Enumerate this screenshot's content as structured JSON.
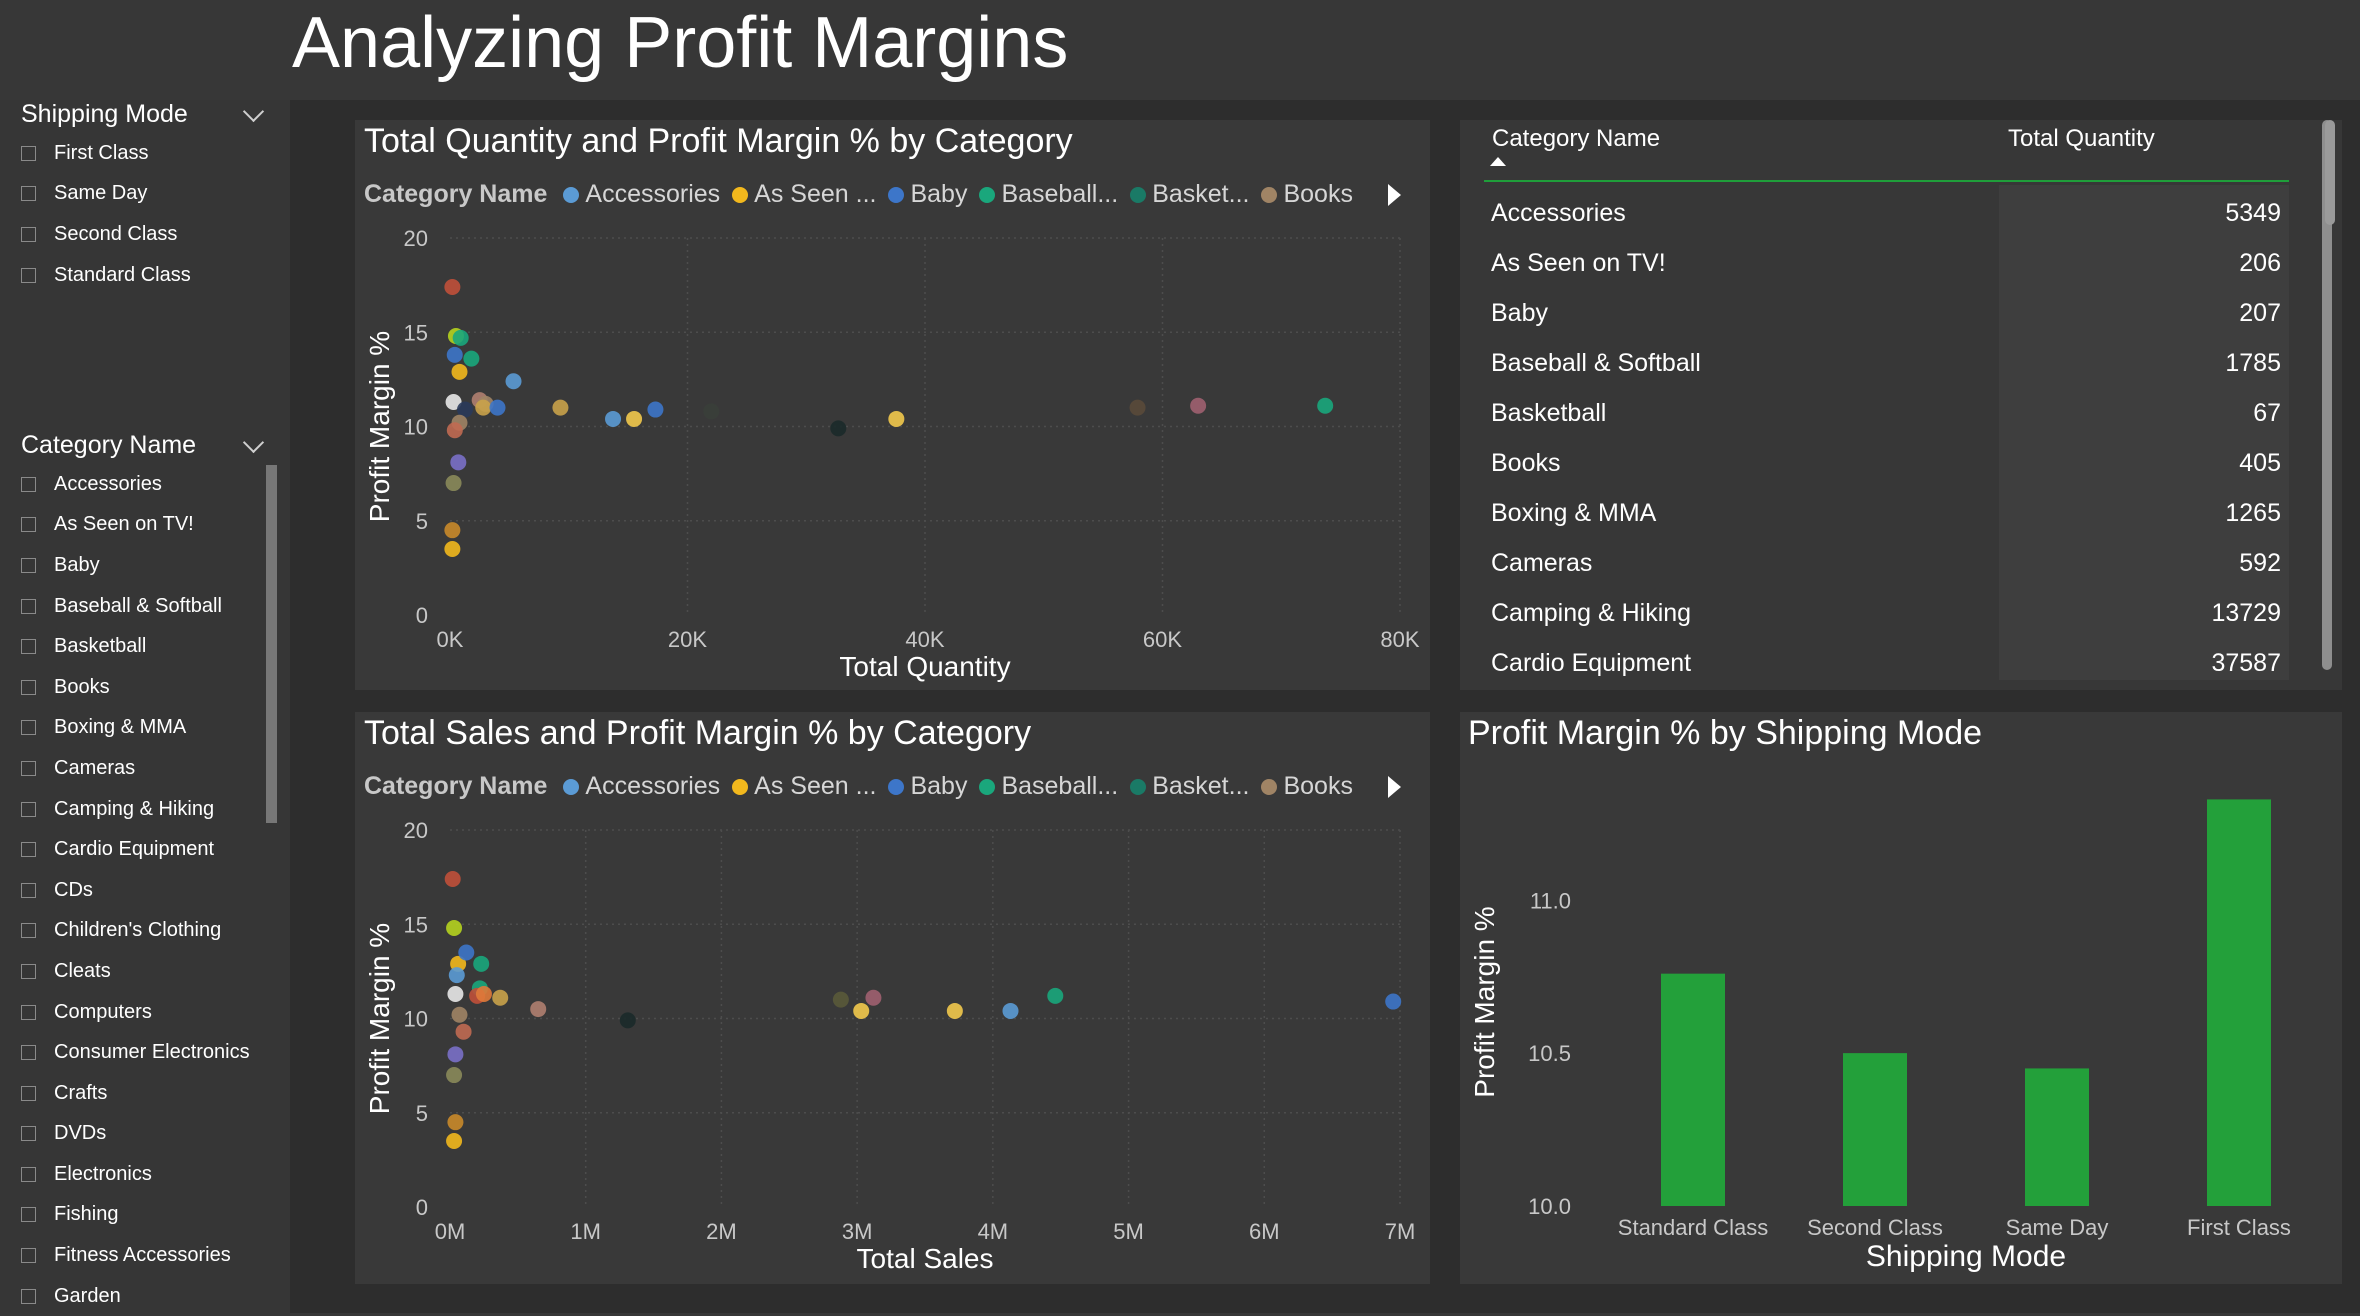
{
  "page_title": "Analyzing Profit Margins",
  "slicers": {
    "shipping": {
      "header": "Shipping Mode",
      "items": [
        "First Class",
        "Same Day",
        "Second Class",
        "Standard Class"
      ]
    },
    "category": {
      "header": "Category Name",
      "items": [
        "Accessories",
        "As Seen on TV!",
        "Baby",
        "Baseball & Softball",
        "Basketball",
        "Books",
        "Boxing & MMA",
        "Cameras",
        "Camping & Hiking",
        "Cardio Equipment",
        "CDs",
        "Children's Clothing",
        "Cleats",
        "Computers",
        "Consumer Electronics",
        "Crafts",
        "DVDs",
        "Electronics",
        "Fishing",
        "Fitness Accessories",
        "Garden"
      ]
    }
  },
  "legend": {
    "title": "Category Name",
    "items": [
      {
        "label": "Accessories",
        "color": "#5b9bd5"
      },
      {
        "label": "As Seen ...",
        "color": "#f2b81d"
      },
      {
        "label": "Baby",
        "color": "#3d76c9"
      },
      {
        "label": "Baseball...",
        "color": "#1aa77c"
      },
      {
        "label": "Basket...",
        "color": "#1a7a66"
      },
      {
        "label": "Books",
        "color": "#a08465"
      }
    ]
  },
  "table": {
    "headers": {
      "category": "Category Name",
      "quantity": "Total Quantity"
    },
    "rows": [
      {
        "name": "Accessories",
        "qty": "5349"
      },
      {
        "name": "As Seen on TV!",
        "qty": "206"
      },
      {
        "name": "Baby",
        "qty": "207"
      },
      {
        "name": "Baseball & Softball",
        "qty": "1785"
      },
      {
        "name": "Basketball",
        "qty": "67"
      },
      {
        "name": "Books",
        "qty": "405"
      },
      {
        "name": "Boxing & MMA",
        "qty": "1265"
      },
      {
        "name": "Cameras",
        "qty": "592"
      },
      {
        "name": "Camping & Hiking",
        "qty": "13729"
      },
      {
        "name": "Cardio Equipment",
        "qty": "37587"
      }
    ]
  },
  "chart_data": [
    {
      "type": "scatter",
      "title": "Total Quantity and Profit Margin % by Category",
      "xlabel": "Total Quantity",
      "ylabel": "Profit Margin %",
      "xlim": [
        0,
        80000
      ],
      "ylim": [
        0,
        20
      ],
      "xticks": [
        0,
        20000,
        40000,
        60000,
        80000
      ],
      "xtick_labels": [
        "0K",
        "20K",
        "40K",
        "60K",
        "80K"
      ],
      "yticks": [
        0,
        5,
        10,
        15,
        20
      ],
      "ytick_labels": [
        "0",
        "5",
        "10",
        "15",
        "20"
      ],
      "grid": true,
      "legend_position": "top",
      "points": [
        {
          "x": 200,
          "y": 17.4,
          "color": "#c0503a"
        },
        {
          "x": 500,
          "y": 14.8,
          "color": "#b5d31f"
        },
        {
          "x": 900,
          "y": 14.7,
          "color": "#1aa77c"
        },
        {
          "x": 1800,
          "y": 13.6,
          "color": "#1aa77c"
        },
        {
          "x": 400,
          "y": 13.8,
          "color": "#3d76c9"
        },
        {
          "x": 800,
          "y": 12.9,
          "color": "#f2b81d"
        },
        {
          "x": 5349,
          "y": 12.4,
          "color": "#5b9bd5"
        },
        {
          "x": 300,
          "y": 11.3,
          "color": "#e8e8e8"
        },
        {
          "x": 1265,
          "y": 10.9,
          "color": "#2a3a5a"
        },
        {
          "x": 2500,
          "y": 11.4,
          "color": "#b08070"
        },
        {
          "x": 3000,
          "y": 11.2,
          "color": "#a08465"
        },
        {
          "x": 2800,
          "y": 11.0,
          "color": "#c9a24a"
        },
        {
          "x": 4000,
          "y": 11.0,
          "color": "#3d76c9"
        },
        {
          "x": 800,
          "y": 10.2,
          "color": "#a08465"
        },
        {
          "x": 405,
          "y": 9.8,
          "color": "#c06a52"
        },
        {
          "x": 700,
          "y": 8.1,
          "color": "#7a70c8"
        },
        {
          "x": 300,
          "y": 7.0,
          "color": "#8a8a5a"
        },
        {
          "x": 200,
          "y": 4.5,
          "color": "#c98a2a"
        },
        {
          "x": 200,
          "y": 3.5,
          "color": "#f2b81d"
        },
        {
          "x": 9300,
          "y": 11.0,
          "color": "#c9a24a"
        },
        {
          "x": 13729,
          "y": 10.4,
          "color": "#5b9bd5"
        },
        {
          "x": 15500,
          "y": 10.4,
          "color": "#f2c94c"
        },
        {
          "x": 17300,
          "y": 10.9,
          "color": "#3d76c9"
        },
        {
          "x": 22000,
          "y": 10.8,
          "color": "#3a3f3a"
        },
        {
          "x": 32700,
          "y": 9.9,
          "color": "#1b2a2a"
        },
        {
          "x": 37587,
          "y": 10.4,
          "color": "#f2c94c"
        },
        {
          "x": 57900,
          "y": 11.0,
          "color": "#5a4a3a"
        },
        {
          "x": 63000,
          "y": 11.1,
          "color": "#a06070"
        },
        {
          "x": 73700,
          "y": 11.1,
          "color": "#1aa77c"
        }
      ]
    },
    {
      "type": "scatter",
      "title": "Total Sales and Profit Margin % by Category",
      "xlabel": "Total Sales",
      "ylabel": "Profit Margin %",
      "xlim": [
        0,
        7000000
      ],
      "ylim": [
        0,
        20
      ],
      "xticks": [
        0,
        1000000,
        2000000,
        3000000,
        4000000,
        5000000,
        6000000,
        7000000
      ],
      "xtick_labels": [
        "0M",
        "1M",
        "2M",
        "3M",
        "4M",
        "5M",
        "6M",
        "7M"
      ],
      "yticks": [
        0,
        5,
        10,
        15,
        20
      ],
      "ytick_labels": [
        "0",
        "5",
        "10",
        "15",
        "20"
      ],
      "grid": true,
      "legend_position": "top",
      "points": [
        {
          "x": 20000,
          "y": 17.4,
          "color": "#c0503a"
        },
        {
          "x": 30000,
          "y": 14.8,
          "color": "#b5d31f"
        },
        {
          "x": 60000,
          "y": 12.9,
          "color": "#f2b81d"
        },
        {
          "x": 120000,
          "y": 13.5,
          "color": "#3d76c9"
        },
        {
          "x": 230000,
          "y": 12.9,
          "color": "#1aa77c"
        },
        {
          "x": 50000,
          "y": 12.3,
          "color": "#5b9bd5"
        },
        {
          "x": 220000,
          "y": 11.6,
          "color": "#1aa77c"
        },
        {
          "x": 40000,
          "y": 11.3,
          "color": "#e8e8e8"
        },
        {
          "x": 200000,
          "y": 11.2,
          "color": "#c0503a"
        },
        {
          "x": 250000,
          "y": 11.3,
          "color": "#e07a3a"
        },
        {
          "x": 370000,
          "y": 11.1,
          "color": "#c9a24a"
        },
        {
          "x": 650000,
          "y": 10.5,
          "color": "#b08070"
        },
        {
          "x": 70000,
          "y": 10.2,
          "color": "#a08465"
        },
        {
          "x": 100000,
          "y": 9.3,
          "color": "#c06a52"
        },
        {
          "x": 40000,
          "y": 8.1,
          "color": "#7a70c8"
        },
        {
          "x": 30000,
          "y": 7.0,
          "color": "#8a8a5a"
        },
        {
          "x": 40000,
          "y": 4.5,
          "color": "#c98a2a"
        },
        {
          "x": 30000,
          "y": 3.5,
          "color": "#f2b81d"
        },
        {
          "x": 1310000,
          "y": 9.9,
          "color": "#1b2a2a"
        },
        {
          "x": 2880000,
          "y": 11.0,
          "color": "#5a5a3a"
        },
        {
          "x": 3030000,
          "y": 10.4,
          "color": "#f2c94c"
        },
        {
          "x": 3120000,
          "y": 11.1,
          "color": "#a06070"
        },
        {
          "x": 3720000,
          "y": 10.4,
          "color": "#f2c94c"
        },
        {
          "x": 4130000,
          "y": 10.4,
          "color": "#5b9bd5"
        },
        {
          "x": 4460000,
          "y": 11.2,
          "color": "#1aa77c"
        },
        {
          "x": 6950000,
          "y": 10.9,
          "color": "#3d76c9"
        }
      ]
    },
    {
      "type": "bar",
      "title": "Profit Margin % by Shipping Mode",
      "xlabel": "Shipping Mode",
      "ylabel": "Profit Margin %",
      "categories": [
        "Standard Class",
        "Second Class",
        "Same Day",
        "First Class"
      ],
      "values": [
        10.76,
        10.5,
        10.45,
        11.33
      ],
      "ylim": [
        10.0,
        11.4
      ],
      "yticks": [
        10.0,
        10.5,
        11.0
      ],
      "ytick_labels": [
        "10.0",
        "10.5",
        "11.0"
      ],
      "color": "#23a03a",
      "grid": false
    }
  ]
}
